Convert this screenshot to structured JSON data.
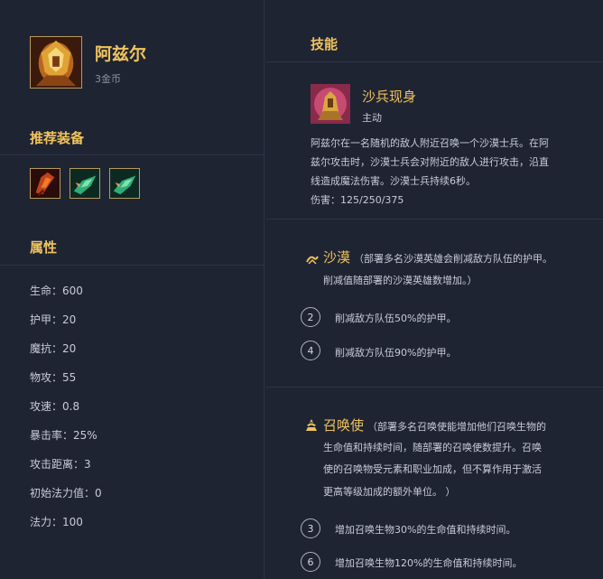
{
  "champion": {
    "name": "阿兹尔",
    "cost": "3金币"
  },
  "sections": {
    "items_title": "推荐装备",
    "stats_title": "属性",
    "skill_title": "技能"
  },
  "items": [
    {
      "name": "red-item-icon",
      "color": "#c0421a"
    },
    {
      "name": "green-item-icon",
      "color": "#2fae78"
    },
    {
      "name": "green-item-icon",
      "color": "#2fae78"
    }
  ],
  "stats": [
    "生命：600",
    "护甲：20",
    "魔抗：20",
    "物攻：55",
    "攻速：0.8",
    "暴击率：25%",
    "攻击距离：3",
    "初始法力值：0",
    "法力：100"
  ],
  "skill": {
    "name": "沙兵现身",
    "type": "主动",
    "desc_lines": [
      "阿兹尔在一名随机的敌人附近召唤一个沙漠士兵。在阿",
      "兹尔攻击时，沙漠士兵会对附近的敌人进行攻击，沿直",
      "线造成魔法伤害。沙漠士兵持续6秒。"
    ],
    "damage": "伤害：125/250/375"
  },
  "traits": [
    {
      "name": "沙漠",
      "icon": "desert-icon",
      "desc_lines": [
        "（部署多名沙漠英雄会削减敌方队伍的护甲。",
        "削减值随部署的沙漠英雄数增加。）"
      ],
      "tiers": [
        {
          "count": "2",
          "text": "削减敌方队伍50%的护甲。"
        },
        {
          "count": "4",
          "text": "削减敌方队伍90%的护甲。"
        }
      ]
    },
    {
      "name": "召唤使",
      "icon": "summoner-icon",
      "desc_lines": [
        "（部署多名召唤使能增加他们召唤生物的",
        "生命值和持续时间，随部署的召唤使数提升。召唤",
        "使的召唤物受元素和职业加成，但不算作用于激活",
        "更高等级加成的额外单位。 ）"
      ],
      "tiers": [
        {
          "count": "3",
          "text": "增加召唤生物30%的生命值和持续时间。"
        },
        {
          "count": "6",
          "text": "增加召唤生物120%的生命值和持续时间。"
        }
      ]
    }
  ],
  "colors": {
    "background": "#1f2433",
    "accent": "#f0c35c",
    "text": "#c8ccd6",
    "divider": "#2e3446"
  }
}
